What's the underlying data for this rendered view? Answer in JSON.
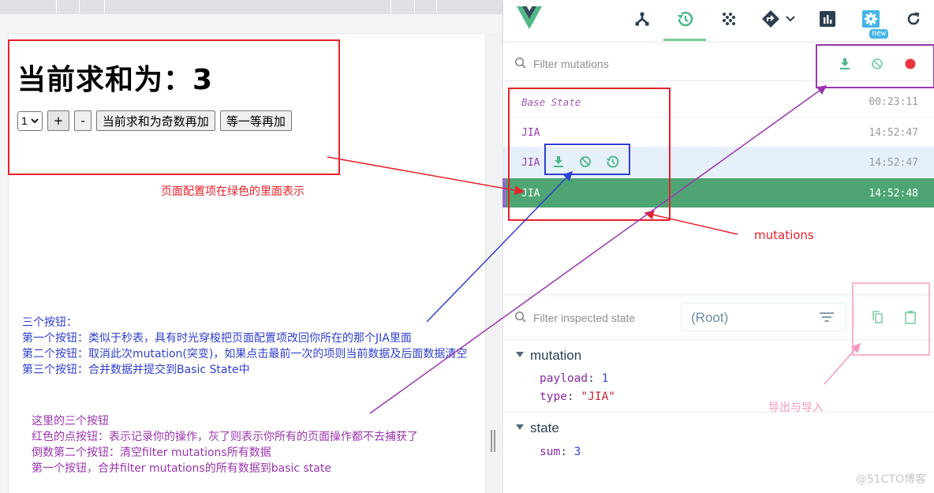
{
  "app": {
    "title_prefix": "当前求和为：",
    "sum_value": "3",
    "select_value": "1",
    "buttons": {
      "increment": "+",
      "decrement": "-",
      "increment_if_odd": "当前求和为奇数再加",
      "increment_wait": "等一等再加"
    }
  },
  "annotations": {
    "page_config_note": "页面配置项在绿色的里面表示",
    "mutations_label": "mutations",
    "export_import_label": "导出与导入",
    "row_buttons_notes": [
      "三个按钮：",
      "第一个按钮：类似于秒表，具有时光穿梭把页面配置项改回你所在的那个JIA里面",
      "第二个按钮：取消此次mutation(突变)，如果点击最前一次的项则当前数据及后面数据清空",
      "第三个按钮：合并数据并提交到Basic State中"
    ],
    "toolbar_buttons_notes": [
      "这里的三个按钮",
      "红色的点按钮：表示记录你的操作，灰了则表示你所有的页面操作都不去捕获了",
      "倒数第二个按钮：清空filter mutations所有数据",
      "第一个按钮，合并filter mutations的所有数据到basic state"
    ],
    "colors": {
      "red": "#e8202a",
      "blue": "#2f3fd0",
      "purple": "#9b34b0",
      "pink": "#f59ac0"
    }
  },
  "devtools": {
    "nav": {
      "icons": [
        "components-icon",
        "vuex-history-icon",
        "events-icon",
        "routing-icon",
        "performance-icon",
        "settings-icon",
        "refresh-icon"
      ],
      "active": "vuex-history-icon",
      "new_badge": "new"
    },
    "mutations": {
      "filter_placeholder": "Filter mutations",
      "toolbar": [
        "commit-all-icon",
        "revert-all-icon",
        "record-icon"
      ],
      "record_color": "#f0343e",
      "rows": [
        {
          "name": "Base State",
          "time": "00:23:11",
          "kind": "base"
        },
        {
          "name": "JIA",
          "time": "14:52:47",
          "kind": "normal"
        },
        {
          "name": "JIA",
          "time": "14:52:47",
          "kind": "hover"
        },
        {
          "name": "JIA",
          "time": "14:52:48",
          "kind": "selected"
        }
      ],
      "selected_color": "#4ea573"
    },
    "inspector": {
      "filter_placeholder": "Filter inspected state",
      "root_select": "(Root)",
      "sections": {
        "mutation": {
          "title": "mutation",
          "payload_key": "payload",
          "payload_value": "1",
          "type_key": "type",
          "type_value": "\"JIA\""
        },
        "state": {
          "title": "state",
          "sum_key": "sum",
          "sum_value": "3"
        }
      }
    }
  },
  "watermark": "@51CTO博客"
}
